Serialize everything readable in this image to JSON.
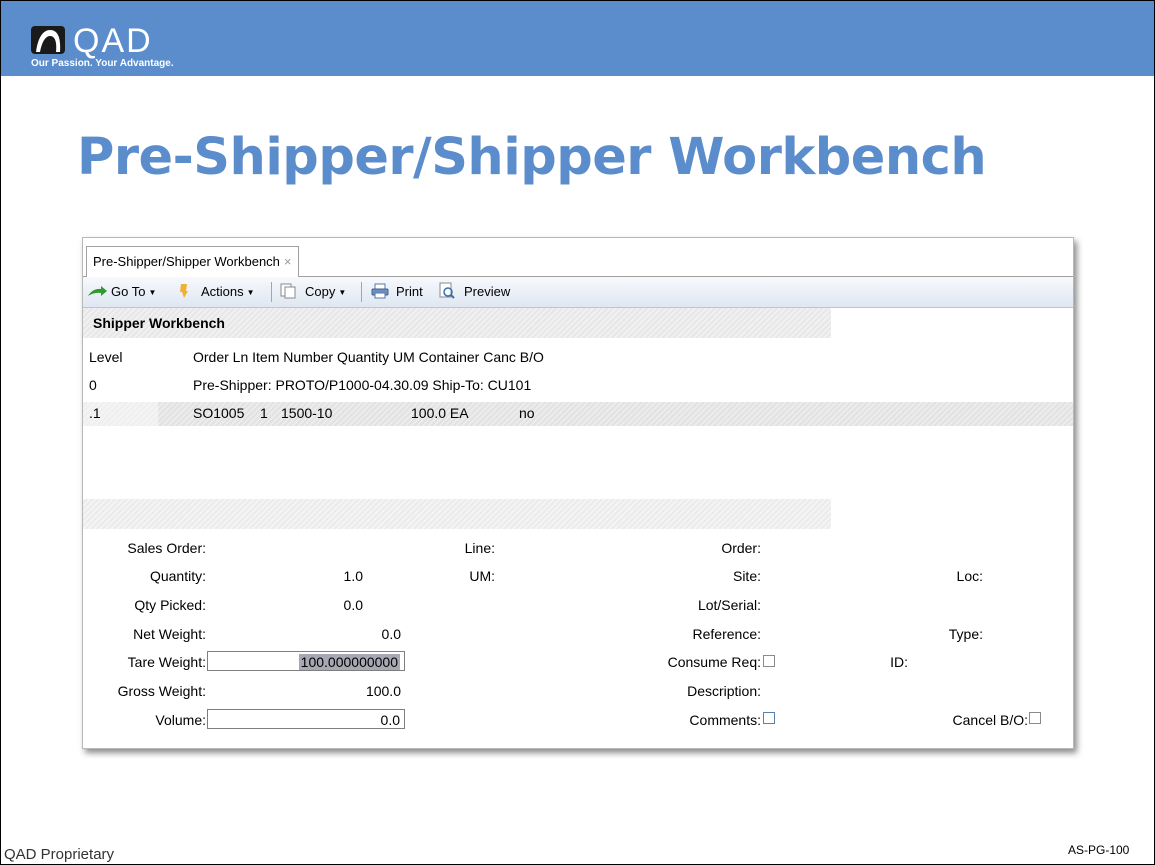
{
  "brand": {
    "name": "QAD",
    "tagline": "Our Passion. Your Advantage."
  },
  "slide": {
    "title": "Pre-Shipper/Shipper Workbench",
    "footer_left": "QAD Proprietary",
    "footer_right": "AS-PG-100"
  },
  "window": {
    "tab_title": "Pre-Shipper/Shipper Workbench",
    "tab_close": "×",
    "toolbar": {
      "goto": "Go To",
      "actions": "Actions",
      "copy": "Copy",
      "print": "Print",
      "preview": "Preview"
    },
    "section_title": "Shipper Workbench",
    "grid": {
      "headers": {
        "level": "Level",
        "columns": "Order  Ln  Item Number     Quantity  UM Container Canc B/O"
      },
      "rows": [
        {
          "level": "0",
          "text": "Pre-Shipper: PROTO/P1000-04.30.09  Ship-To: CU101"
        },
        {
          "level": ".1",
          "order": "SO1005",
          "ln": "1",
          "item": "1500-10",
          "qty_um": "100.0 EA",
          "canc": "no"
        }
      ]
    },
    "form": {
      "sales_order_label": "Sales Order:",
      "quantity_label": "Quantity:",
      "quantity_value": "1.0",
      "qty_picked_label": "Qty Picked:",
      "qty_picked_value": "0.0",
      "net_weight_label": "Net Weight:",
      "net_weight_value": "0.0",
      "tare_weight_label": "Tare Weight:",
      "tare_weight_value": "100.000000000",
      "gross_weight_label": "Gross Weight:",
      "gross_weight_value": "100.0",
      "volume_label": "Volume:",
      "volume_value": "0.0",
      "line_label": "Line:",
      "um_label": "UM:",
      "order_label": "Order:",
      "site_label": "Site:",
      "lot_serial_label": "Lot/Serial:",
      "reference_label": "Reference:",
      "consume_req_label": "Consume Req:",
      "description_label": "Description:",
      "comments_label": "Comments:",
      "loc_label": "Loc:",
      "type_label": "Type:",
      "id_label": "ID:",
      "cancel_bo_label": "Cancel B/O:"
    }
  }
}
